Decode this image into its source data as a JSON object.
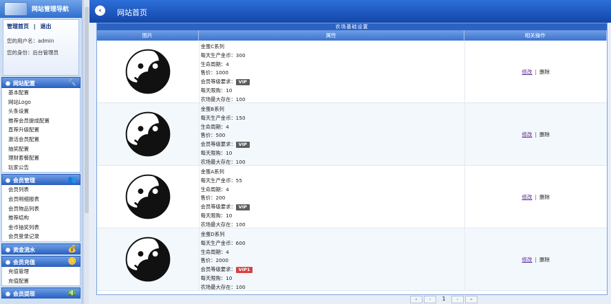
{
  "sidebar": {
    "title": "网站管理导航",
    "links": {
      "home": "管理首页",
      "sep": "|",
      "logout": "退出"
    },
    "user_label": "您的用户名：admin",
    "role_label": "您的身份：后台管理员",
    "sections": [
      {
        "title": "网站配置",
        "icon": "tools-icon",
        "items": [
          "基本配置",
          "网站Logo",
          "头条设置",
          "推荐会员提成配置",
          "直荐升级配置",
          "激活会员配置",
          "抽奖配置",
          "理财套餐配置",
          "玩家公告"
        ]
      },
      {
        "title": "会员管理",
        "icon": "users-icon",
        "items": [
          "会员列表",
          "会员明细报表",
          "会员物品列表",
          "推荐结构",
          "金币抽奖列表",
          "会员登录记录"
        ]
      },
      {
        "title": "资金流水",
        "icon": "money-icon",
        "items": []
      },
      {
        "title": "会员充值",
        "icon": "coins-icon",
        "items": [
          "充值管理",
          "充值配置"
        ]
      },
      {
        "title": "会员提现",
        "icon": "cash-icon",
        "items": []
      }
    ]
  },
  "topbar": {
    "back_icon": "back-arrow-icon",
    "title": "网站首页"
  },
  "table": {
    "caption": "农场基础设置",
    "headers": [
      "图片",
      "属性",
      "相关操作"
    ],
    "rows": [
      {
        "lines": [
          "金蛋C系列",
          "每天生产金币：300",
          "生命周期：4",
          "售价：1000"
        ],
        "vip_label": "会员等级要求：",
        "vip": "VIP",
        "vip_color": "grey",
        "after": [
          "每天限购：10",
          "农场最大存在：100"
        ]
      },
      {
        "lines": [
          "金蛋B系列",
          "每天生产金币：150",
          "生命周期：4",
          "售价：500"
        ],
        "vip_label": "会员等级要求：",
        "vip": "VIP",
        "vip_color": "grey",
        "after": [
          "每天限购：10",
          "农场最大存在：100"
        ]
      },
      {
        "lines": [
          "金蛋A系列",
          "每天生产金币：55",
          "生命周期：4",
          "售价：200"
        ],
        "vip_label": "会员等级要求：",
        "vip": "VIP",
        "vip_color": "grey",
        "after": [
          "每天限购：10",
          "农场最大存在：100"
        ]
      },
      {
        "lines": [
          "金蛋D系列",
          "每天生产金币：600",
          "生命周期：4",
          "售价：2000"
        ],
        "vip_label": "会员等级要求：",
        "vip": "VIP1",
        "vip_color": "red",
        "after": [
          "每天限购：10",
          "农场最大存在：100"
        ]
      }
    ],
    "ops": {
      "edit": "修改",
      "sep": "|",
      "delete": "删除"
    }
  },
  "pager": {
    "first": "«",
    "prev": "‹",
    "current": "1",
    "next": "›",
    "last": "»"
  }
}
